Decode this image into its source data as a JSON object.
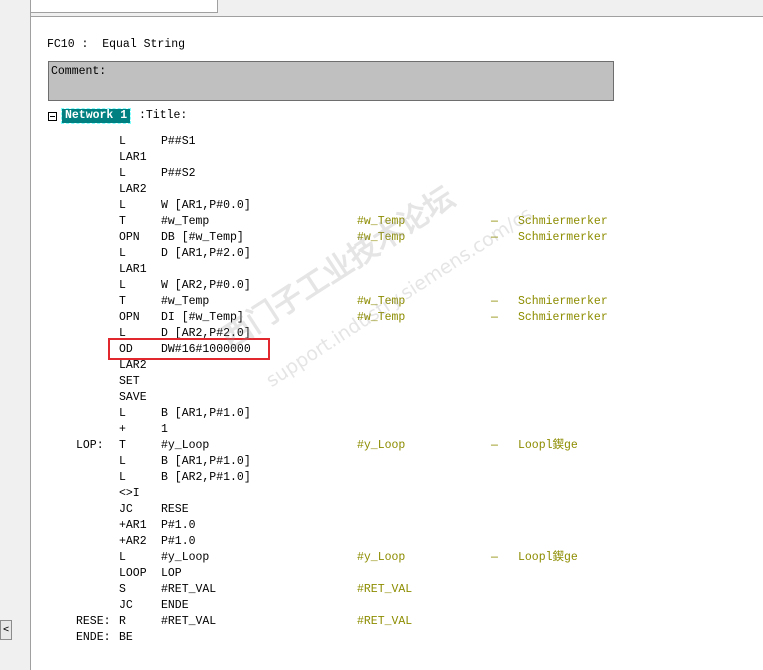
{
  "block_title": "FC10 :  Equal String",
  "comment_label": "Comment:",
  "network": {
    "label": "Network 1",
    "title": ":Title:"
  },
  "left_strip_glyph": "<",
  "code_lines": [
    {
      "label": "",
      "op": "L",
      "arg": "P##S1",
      "sym": "",
      "dash": "",
      "cmt": ""
    },
    {
      "label": "",
      "op": "LAR1",
      "arg": "",
      "sym": "",
      "dash": "",
      "cmt": ""
    },
    {
      "label": "",
      "op": "L",
      "arg": "P##S2",
      "sym": "",
      "dash": "",
      "cmt": ""
    },
    {
      "label": "",
      "op": "LAR2",
      "arg": "",
      "sym": "",
      "dash": "",
      "cmt": ""
    },
    {
      "label": "",
      "op": "L",
      "arg": "W [AR1,P#0.0]",
      "sym": "",
      "dash": "",
      "cmt": ""
    },
    {
      "label": "",
      "op": "T",
      "arg": "#w_Temp",
      "sym": "#w_Temp",
      "dash": "—",
      "cmt": "Schmiermerker"
    },
    {
      "label": "",
      "op": "OPN",
      "arg": "DB [#w_Temp]",
      "sym": "#w_Temp",
      "dash": "—",
      "cmt": "Schmiermerker"
    },
    {
      "label": "",
      "op": "L",
      "arg": "D [AR1,P#2.0]",
      "sym": "",
      "dash": "",
      "cmt": ""
    },
    {
      "label": "",
      "op": "LAR1",
      "arg": "",
      "sym": "",
      "dash": "",
      "cmt": ""
    },
    {
      "label": "",
      "op": "L",
      "arg": "W [AR2,P#0.0]",
      "sym": "",
      "dash": "",
      "cmt": ""
    },
    {
      "label": "",
      "op": "T",
      "arg": "#w_Temp",
      "sym": "#w_Temp",
      "dash": "—",
      "cmt": "Schmiermerker"
    },
    {
      "label": "",
      "op": "OPN",
      "arg": "DI [#w_Temp]",
      "sym": "#w_Temp",
      "dash": "—",
      "cmt": "Schmiermerker"
    },
    {
      "label": "",
      "op": "L",
      "arg": "D [AR2,P#2.0]",
      "sym": "",
      "dash": "",
      "cmt": ""
    },
    {
      "label": "",
      "op": "OD",
      "arg": "DW#16#1000000",
      "sym": "",
      "dash": "",
      "cmt": ""
    },
    {
      "label": "",
      "op": "LAR2",
      "arg": "",
      "sym": "",
      "dash": "",
      "cmt": ""
    },
    {
      "label": "",
      "op": "SET",
      "arg": "",
      "sym": "",
      "dash": "",
      "cmt": ""
    },
    {
      "label": "",
      "op": "SAVE",
      "arg": "",
      "sym": "",
      "dash": "",
      "cmt": ""
    },
    {
      "label": "",
      "op": "L",
      "arg": "B [AR1,P#1.0]",
      "sym": "",
      "dash": "",
      "cmt": ""
    },
    {
      "label": "",
      "op": "+",
      "arg": "1",
      "sym": "",
      "dash": "",
      "cmt": ""
    },
    {
      "label": "LOP:",
      "op": "T",
      "arg": "#y_Loop",
      "sym": "#y_Loop",
      "dash": "—",
      "cmt": "Loopl鍥ge"
    },
    {
      "label": "",
      "op": "L",
      "arg": "B [AR1,P#1.0]",
      "sym": "",
      "dash": "",
      "cmt": ""
    },
    {
      "label": "",
      "op": "L",
      "arg": "B [AR2,P#1.0]",
      "sym": "",
      "dash": "",
      "cmt": ""
    },
    {
      "label": "",
      "op": "<>I",
      "arg": "",
      "sym": "",
      "dash": "",
      "cmt": ""
    },
    {
      "label": "",
      "op": "JC",
      "arg": "RESE",
      "sym": "",
      "dash": "",
      "cmt": ""
    },
    {
      "label": "",
      "op": "+AR1",
      "arg": "P#1.0",
      "sym": "",
      "dash": "",
      "cmt": ""
    },
    {
      "label": "",
      "op": "+AR2",
      "arg": "P#1.0",
      "sym": "",
      "dash": "",
      "cmt": ""
    },
    {
      "label": "",
      "op": "L",
      "arg": "#y_Loop",
      "sym": "#y_Loop",
      "dash": "—",
      "cmt": "Loopl鍥ge"
    },
    {
      "label": "",
      "op": "LOOP",
      "arg": "LOP",
      "sym": "",
      "dash": "",
      "cmt": ""
    },
    {
      "label": "",
      "op": "S",
      "arg": "#RET_VAL",
      "sym": "#RET_VAL",
      "dash": "",
      "cmt": ""
    },
    {
      "label": "",
      "op": "JC",
      "arg": "ENDE",
      "sym": "",
      "dash": "",
      "cmt": ""
    },
    {
      "label": "RESE:",
      "op": "R",
      "arg": "#RET_VAL",
      "sym": "#RET_VAL",
      "dash": "",
      "cmt": ""
    },
    {
      "label": "ENDE:",
      "op": "BE",
      "arg": "",
      "sym": "",
      "dash": "",
      "cmt": ""
    }
  ],
  "watermark": {
    "line1": "西门子工业技术论坛",
    "line2": "support.industry.siemens.com/cs"
  },
  "colors": {
    "network_tag_bg": "#008080",
    "symbol_text": "#8c8c00",
    "highlight_border": "#e0282e",
    "comment_bg": "#c0c0c0"
  }
}
